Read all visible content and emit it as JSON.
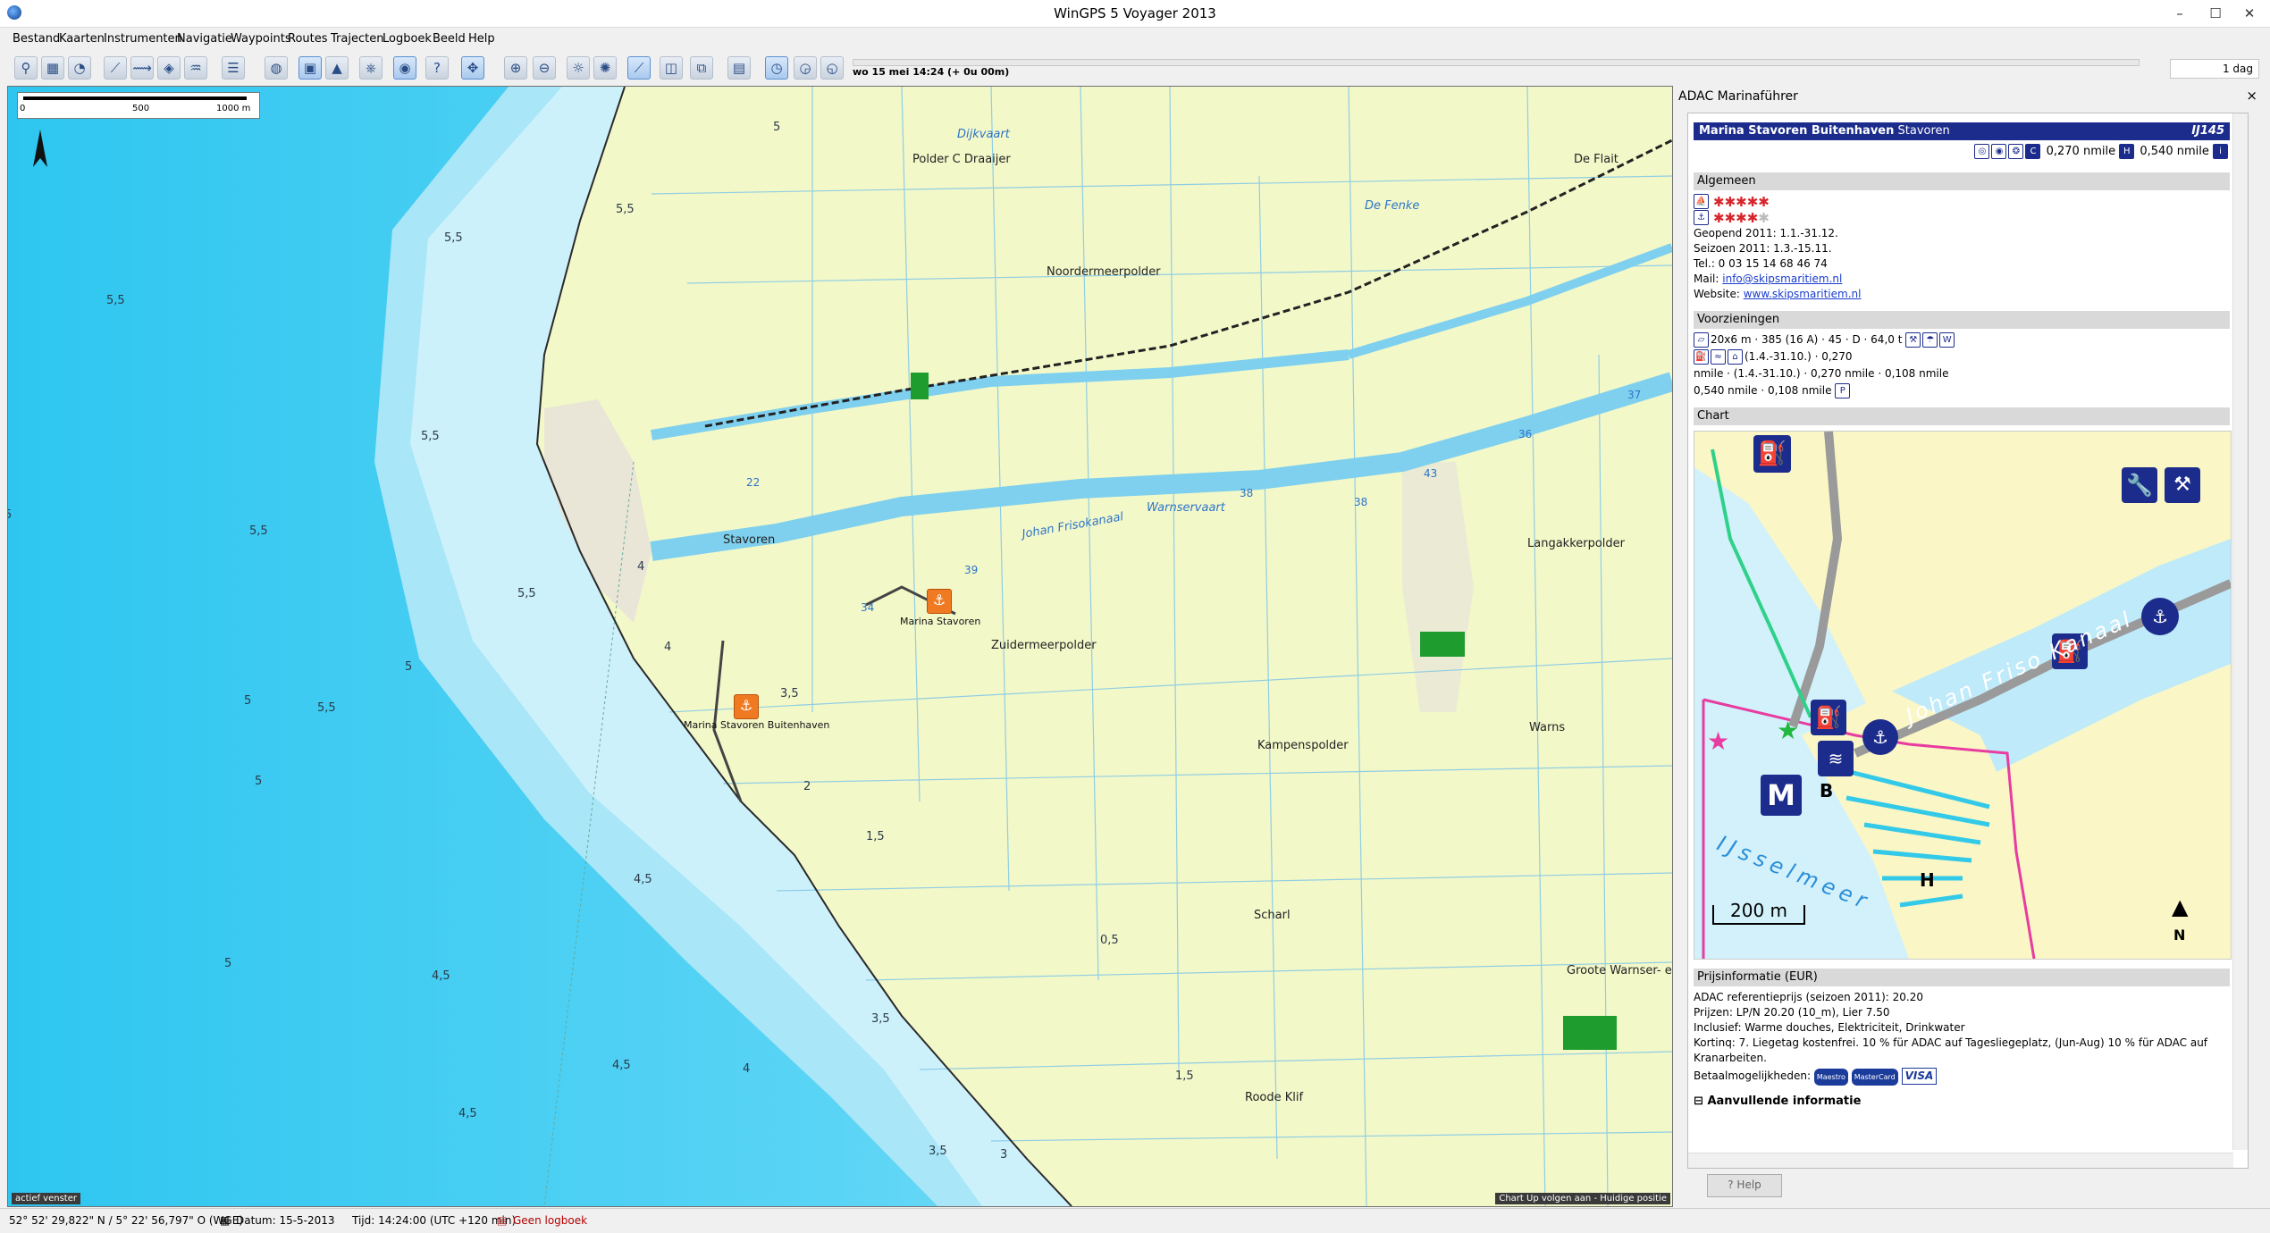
{
  "window": {
    "title": "WinGPS 5 Voyager 2013",
    "minimize": "–",
    "maximize": "☐",
    "close": "✕"
  },
  "menu": [
    "Bestand",
    "Kaarten",
    "Instrumenten",
    "Navigatie",
    "Waypoints",
    "Routes",
    "Trajecten",
    "Logboek",
    "Beeld",
    "Help"
  ],
  "timeline": {
    "label": "wo 15 mei 14:24  (+ 0u 00m)",
    "zoom": "1 dag"
  },
  "map": {
    "scale": {
      "t0": "0",
      "t1": "500",
      "t2": "1000 m"
    },
    "places": [
      "Polder C Draaijer",
      "De Flait",
      "Noordermeerpolder",
      "Stavoren",
      "Langakkerpolder",
      "Zuidermeerpolder",
      "Kampenspolder",
      "Warns",
      "Scharl",
      "Groote Warnser- e",
      "Roode Klif"
    ],
    "water_labels": [
      "Dijkvaart",
      "De Fenke",
      "Johan Frisokanaal",
      "Warnservaart"
    ],
    "km_markers": [
      "37",
      "36",
      "38",
      "38",
      "39",
      "43",
      "22",
      "34"
    ],
    "depths": [
      "5",
      "5,5",
      "5,5",
      "5,5",
      "5,5",
      "5,5",
      "5",
      "5,5",
      "5",
      "5",
      "5",
      "4",
      "4",
      "4,5",
      "4,5",
      "4,5",
      "4,5",
      "4",
      "3,5",
      "3,5",
      "3",
      "2",
      "1,5",
      "1,5",
      "0,5",
      "3,5",
      "5,5",
      "5"
    ],
    "marinas": [
      "Marina Stavoren",
      "Marina Stavoren Buitenhaven"
    ],
    "status_left": "actief venster",
    "status_right": "Chart Up volgen aan - Huidige positie"
  },
  "panel": {
    "title": "ADAC Marinaführer",
    "close": "×",
    "marina_name": "Marina Stavoren Buitenhaven",
    "marina_place": "Stavoren",
    "marina_code": "IJ145",
    "dist1": "0,270 nmile",
    "dist2": "0,540 nmile",
    "sections": {
      "general": "Algemeen",
      "facilities": "Voorzieningen",
      "chart": "Chart",
      "prices": "Prijsinformatie (EUR)",
      "more": "Aanvullende informatie"
    },
    "general_lines": [
      "Geopend 2011: 1.1.-31.12.",
      "Seizoen 2011: 1.3.-15.11.",
      "Tel.: 0 03 15 14 68 46 74"
    ],
    "mail_label": "Mail:",
    "mail": "info@skipsmaritiem.nl",
    "web_label": "Website:",
    "web": "www.skipsmaritiem.nl",
    "fac_line1": "20x6 m · 385 (16 A) · 45 · D · 64,0 t",
    "fac_line2": "(1.4.-31.10.) · 0,270",
    "fac_line3": "nmile · (1.4.-31.10.) · 0,270 nmile · 0,108 nmile",
    "fac_line4": "0,540 nmile · 0,108 nmile",
    "chart_labels": {
      "canal": "Johan Friso Kanaal",
      "lake": "IJsselmeer",
      "scale": "200 m",
      "north": "N",
      "b": "B",
      "h": "H",
      "m": "M"
    },
    "price_lines": [
      "ADAC referentieprijs (seizoen 2011): 20.20",
      "Prijzen: LP/N 20.20 (10_m), Lier 7.50",
      "Inclusief: Warme douches, Elektriciteit, Drinkwater",
      "Kortinq: 7. Liegetag kostenfrei. 10 % für ADAC auf Tagesliegeplatz, (Jun-Aug) 10 % für ADAC auf",
      "Kranarbeiten."
    ],
    "payment_label": "Betaalmogelijkheden:",
    "payment": [
      "Maestro",
      "MasterCard",
      "VISA"
    ],
    "help": "Help"
  },
  "status": {
    "coords": "52° 52' 29,822\" N / 5° 22' 56,797\" O (WGE)",
    "date": "Datum: 15-5-2013",
    "time": "Tijd: 14:24:00 (UTC +120 min)",
    "logbook": "Geen logboek"
  },
  "colors": {
    "sea_deep": "#33ccf2",
    "sea_light": "#a9e8fa",
    "land": "#f3f8c9",
    "header": "#1c2c8c",
    "marina": "#f07a22"
  }
}
